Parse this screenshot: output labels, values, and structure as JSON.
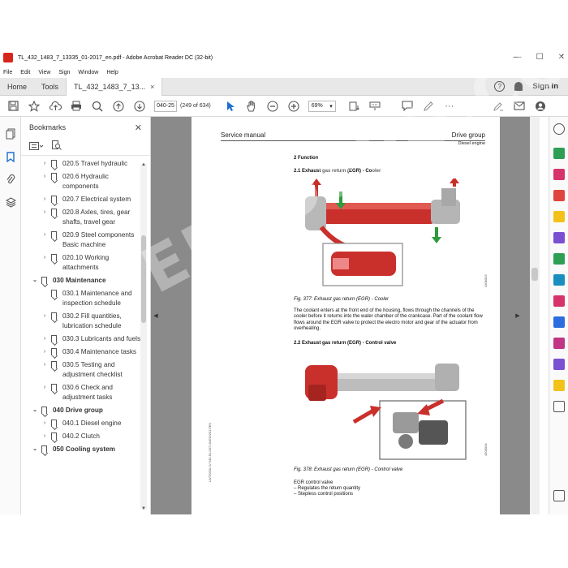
{
  "window": {
    "title": "TL_432_1483_7_13335_01-2017_en.pdf - Adobe Acrobat Reader DC (32-bit)",
    "minimize": "—",
    "maximize": "☐",
    "close": "✕"
  },
  "menu": [
    "File",
    "Edit",
    "View",
    "Sign",
    "Window",
    "Help"
  ],
  "tabs": {
    "home": "Home",
    "tools": "Tools",
    "doc": "TL_432_1483_7_13...",
    "doc_close": "×",
    "help": "?",
    "signin": "Sign In"
  },
  "toolbar": {
    "page_value": "040-25",
    "page_count": "(249 of 634)",
    "zoom_value": "69%",
    "zoom_arrow": "▾",
    "save_icon": "save-icon",
    "more": "···"
  },
  "bookmarks": {
    "title": "Bookmarks",
    "close": "✕",
    "items": [
      {
        "label": "020.5 Travel hydraulic",
        "level": 2,
        "expander": "›"
      },
      {
        "label": "020.6 Hydraulic components",
        "level": 2,
        "expander": "›"
      },
      {
        "label": "020.7 Electrical system",
        "level": 2,
        "expander": "›"
      },
      {
        "label": "020.8 Axles, tires, gear shafts, travel gear",
        "level": 2,
        "expander": "›"
      },
      {
        "label": "020.9 Steel components Basic machine",
        "level": 2,
        "expander": "›"
      },
      {
        "label": "020.10 Working attachments",
        "level": 2,
        "expander": "›"
      },
      {
        "label": "030 Maintenance",
        "level": 1,
        "expander": "⌄"
      },
      {
        "label": "030.1 Maintenance and inspection schedule",
        "level": 2,
        "expander": ""
      },
      {
        "label": "030.2 Fill quantities, lubrication schedule",
        "level": 2,
        "expander": "›"
      },
      {
        "label": "030.3 Lubricants and fuels",
        "level": 2,
        "expander": "›"
      },
      {
        "label": "030.4 Maintenance tasks",
        "level": 2,
        "expander": "›"
      },
      {
        "label": "030.5 Testing and adjustment checklist",
        "level": 2,
        "expander": "›"
      },
      {
        "label": "030.6 Check and adjustment tasks",
        "level": 2,
        "expander": "›"
      },
      {
        "label": "040 Drive group",
        "level": 1,
        "expander": "⌄"
      },
      {
        "label": "040.1 Diesel engine",
        "level": 2,
        "expander": "›"
      },
      {
        "label": "040.2 Clutch",
        "level": 2,
        "expander": "›"
      },
      {
        "label": "050 Cooling system",
        "level": 1,
        "expander": "⌄"
      }
    ]
  },
  "page": {
    "header_left": "Service manual",
    "header_right": "Drive group",
    "subheader": "Diesel engine",
    "section": "2 Function",
    "sub1": "2.1 Exhaust gas return (EGR) - Cooler",
    "fig1_id": "4308003",
    "fig1_caption": "Fig. 377: Exhaust gas return (EGR) - Cooler",
    "para1": "The coolant enters at the front end of the housing, flows through the channels of the cooler before it returns into the water chamber of the crankcase. Part of the coolant flow flows around the EGR valve to protect the electro motor and gear of the actuator from overheating.",
    "sub2": "2.2 Exhaust gas return (EGR) - Control valve",
    "fig2_id": "4308004",
    "fig2_caption": "Fig. 378: Exhaust gas return (EGR) - Control valve",
    "list_title": "EGR control valve",
    "list": [
      "–  Regulates the return quantity",
      "–  Stepless control positions"
    ],
    "side_id": "LWT/0501 5/ 543-81-007-01/ED/2017/EN"
  },
  "watermark": "EPCDEPO.COM",
  "colors": {
    "egr_red": "#d32b2b",
    "arrow_green": "#2e9b3c",
    "bg_gray": "#8a8a8a"
  }
}
